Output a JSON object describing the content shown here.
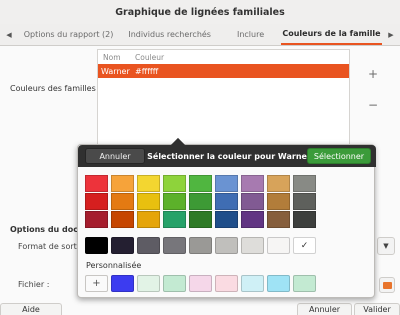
{
  "window": {
    "title": "Graphique de lignées familiales"
  },
  "tabs": [
    {
      "label": "Options du rapport (2)"
    },
    {
      "label": "Individus recherchés"
    },
    {
      "label": "Inclure"
    },
    {
      "label": "Couleurs de la famille"
    }
  ],
  "family_colors": {
    "label": "Couleurs des familles :",
    "columns": {
      "name": "Nom",
      "color": "Couleur"
    },
    "rows": [
      {
        "name": "Warner",
        "color": "#ffffff"
      }
    ],
    "add_icon": "plus-icon",
    "remove_icon": "minus-icon"
  },
  "document_options": {
    "label": "Options du docum",
    "format_label": "Format de sortie",
    "file_label": "Fichier :"
  },
  "bottom_buttons": {
    "help": "Aide",
    "cancel": "Annuler",
    "validate": "Valider"
  },
  "color_picker": {
    "cancel": "Annuler",
    "title": "Sélectionner la couleur pour Warner",
    "select": "Sélectionner",
    "custom_label": "Personnalisée",
    "palette_rows": [
      [
        "#ed333b",
        "#f6a33a",
        "#f3d630",
        "#8ed33b",
        "#50b640",
        "#6a93d2",
        "#a77ab0",
        "#d7a35a",
        "#888a85",
        "#eeeeec"
      ],
      [
        "#d61f1f",
        "#e47a12",
        "#e8c00f",
        "#5cb12a",
        "#3d9a35",
        "#3f6db3",
        "#815a93",
        "#b27d3a",
        "#5e605c",
        "#d3d7cf"
      ],
      [
        "#a51d2d",
        "#c64600",
        "#e5a50a",
        "#26a269",
        "#2e7a26",
        "#1f4e8a",
        "#613583",
        "#865e3c",
        "#3d3f3d",
        "#babdb6"
      ]
    ],
    "grayscale": [
      "#000000",
      "#241f31",
      "#5e5c64",
      "#77767b",
      "#9a9996",
      "#c0bfbc",
      "#deddda",
      "#f6f5f4",
      "#ffffff"
    ],
    "custom": [
      "#3c3cf0",
      "#e2f3e6",
      "#c3ead2",
      "#f5d7e9",
      "#fadbe2",
      "#cff0f6",
      "#9fe3f5",
      "#c3ead2"
    ],
    "selected_icon": "check-icon"
  }
}
